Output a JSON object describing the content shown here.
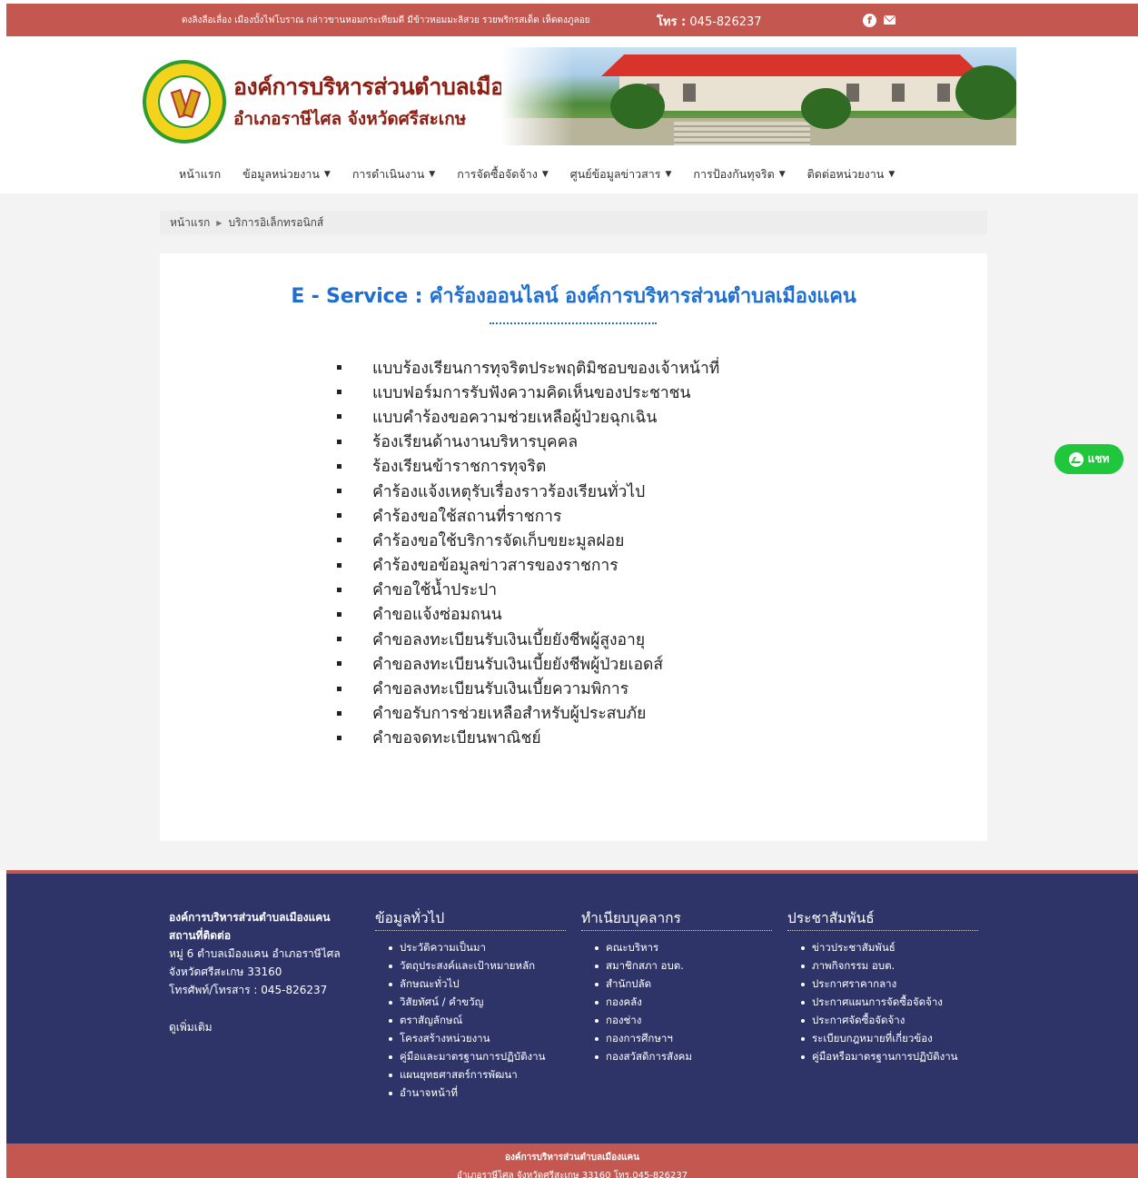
{
  "topbar": {
    "slogan": "ดงลิงลือเลื่อง เมืองบั้งไฟโบราณ กล่าวขานหอมกระเทียมดี มีข้าวหอมมะลิสวย รวยพริกรสเด็ด เห็ดดงภูลอย",
    "phone_label": "โทร :",
    "phone": "045-826237",
    "facebook_icon": "facebook-icon",
    "mail_icon": "mail-icon"
  },
  "header": {
    "org_name": "องค์การบริหารส่วนตำบลเมืองแคน",
    "org_sub": "อำเภอราษีไศล จังหวัดศรีสะเกษ"
  },
  "nav": [
    {
      "label": "หน้าแรก",
      "dropdown": false
    },
    {
      "label": "ข้อมูลหน่วยงาน",
      "dropdown": true
    },
    {
      "label": "การดำเนินงาน",
      "dropdown": true
    },
    {
      "label": "การจัดซื้อจัดจ้าง",
      "dropdown": true
    },
    {
      "label": "ศูนย์ข้อมูลข่าวสาร",
      "dropdown": true
    },
    {
      "label": "การป้องกันทุจริต",
      "dropdown": true
    },
    {
      "label": "ติดต่อหน่วยงาน",
      "dropdown": true
    }
  ],
  "breadcrumb": {
    "home": "หน้าแรก",
    "current": "บริการอิเล็กทรอนิกส์"
  },
  "main": {
    "title": "E - Service : คำร้องออนไลน์ องค์การบริหารส่วนตำบลเมืองแคน",
    "services": [
      "แบบร้องเรียนการทุจริตประพฤติมิชอบของเจ้าหน้าที่",
      "แบบฟอร์มการรับฟังความคิดเห็นของประชาชน",
      "แบบคำร้องขอความช่วยเหลือผู้ป่วยฉุกเฉิน",
      "ร้องเรียนด้านงานบริหารบุคคล",
      "ร้องเรียนข้าราชการทุจริต",
      "คำร้องแจ้งเหตุรับเรื่องราวร้องเรียนทั่วไป",
      "คำร้องขอใช้สถานที่ราชการ",
      "คำร้องขอใช้บริการจัดเก็บขยะมูลฝอย",
      "คำร้องขอข้อมูลข่าวสารของราชการ",
      "คำขอใช้น้ำประปา",
      "คำขอแจ้งซ่อมถนน",
      "คำขอลงทะเบียนรับเงินเบี้ยยังชีพผู้สูงอายุ",
      "คำขอลงทะเบียนรับเงินเบี้ยยังชีพผู้ป่วยเอดส์",
      "คำขอลงทะเบียนรับเงินเบี้ยความพิการ",
      "คำขอรับการช่วยเหลือสำหรับผู้ประสบภัย",
      "คำขอจดทะเบียนพาณิชย์"
    ]
  },
  "chat": {
    "label": "แชท"
  },
  "footer": {
    "contact": {
      "org": "องค์การบริหารส่วนตำบลเมืองแคน",
      "heading": "สถานที่ติดต่อ",
      "address1": "หมู่ 6 ตำบลเมืองแคน อำเภอราษีไศล",
      "address2": "จังหวัดศรีสะเกษ 33160",
      "tel": "โทรศัพท์/โทรสาร : 045-826237",
      "more": "ดูเพิ่มเติม"
    },
    "columns": [
      {
        "title": "ข้อมูลทั่วไป",
        "items": [
          "ประวัติความเป็นมา",
          "วัตถุประสงค์และเป้าหมายหลัก",
          "ลักษณะทั่วไป",
          "วิสัยทัศน์ / คำขวัญ",
          "ตราสัญลักษณ์",
          "โครงสร้างหน่วยงาน",
          "คู่มือและมาตรฐานการปฏิบัติงาน",
          "แผนยุทธศาสตร์การพัฒนา",
          "อำนาจหน้าที่"
        ]
      },
      {
        "title": "ทำเนียบบุคลากร",
        "items": [
          "คณะบริหาร",
          "สมาชิกสภา อบต.",
          "สำนักปลัด",
          "กองคลัง",
          "กองช่าง",
          "กองการศึกษาฯ",
          "กองสวัสดิการสังคม"
        ]
      },
      {
        "title": "ประชาสัมพันธ์",
        "items": [
          "ข่าวประชาสัมพันธ์",
          "ภาพกิจกรรม อบต.",
          "ประกาศราคากลาง",
          "ประกาศแผนการจัดซื้อจัดจ้าง",
          "ประกาศจัดซื้อจัดจ้าง",
          "ระเบียบกฎหมายที่เกี่ยวข้อง",
          "คู่มือหรือมาตรฐานการปฏิบัติงาน"
        ]
      }
    ],
    "bottom_line1": "องค์การบริหารส่วนตำบลเมืองแคน",
    "bottom_line2": "อำเภอราษีไศล จังหวัดศรีสะเกษ 33160 โทร.045-826237"
  },
  "colors": {
    "accent": "#c4574f",
    "footer_bg": "#2e3467",
    "title_blue": "#1e6fd1",
    "chat_green": "#20c63b",
    "brand_red": "#8a1f14"
  }
}
